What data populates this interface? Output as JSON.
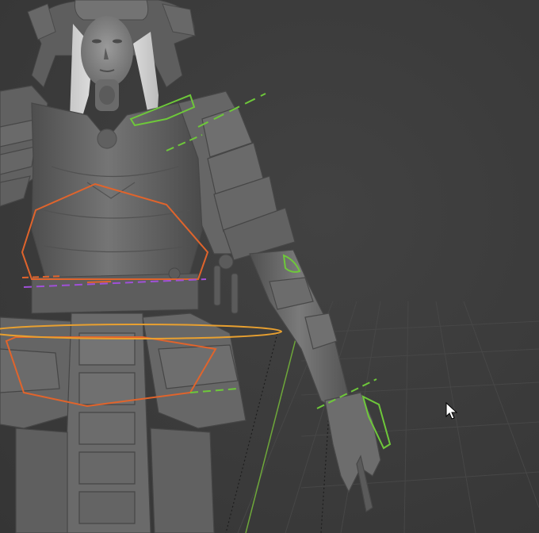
{
  "viewport": {
    "mode": "3d-viewport",
    "shading": "solid-clay",
    "background_color": "#3a3a3a",
    "grid_color": "#4a4a4a",
    "y_axis_color": "#6ea83a"
  },
  "scene": {
    "model": "samurai-armored-woman",
    "model_color": "#6b6b6b",
    "rig_controls": [
      {
        "name": "chest-control",
        "color": "#e0642c"
      },
      {
        "name": "hip-control",
        "color": "#e0642c"
      },
      {
        "name": "waist-ring-control",
        "color": "#e8a030"
      },
      {
        "name": "spine-dashed-control",
        "color": "#a050d8"
      },
      {
        "name": "shoulder-ik-control",
        "color": "#6ec83a"
      },
      {
        "name": "elbow-control",
        "color": "#6ec83a"
      },
      {
        "name": "wrist-ik-control",
        "color": "#6ec83a"
      },
      {
        "name": "hand-control",
        "color": "#6ec83a"
      }
    ]
  },
  "cursor": {
    "icon": "arrow-cursor-icon"
  }
}
